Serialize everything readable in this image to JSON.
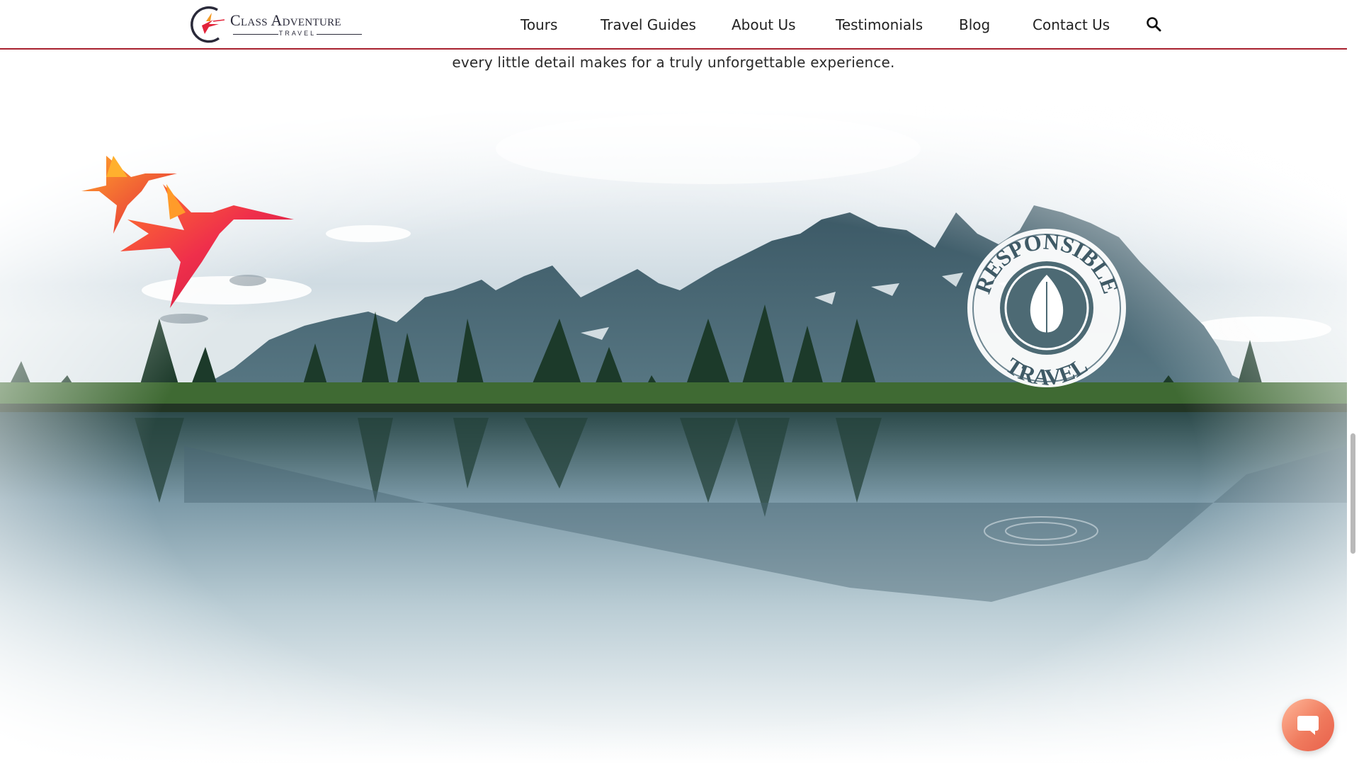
{
  "brand": {
    "name": "Class Adventure",
    "tagline": "TRAVEL"
  },
  "nav": {
    "items": [
      {
        "label": "Tours"
      },
      {
        "label": "Travel Guides"
      },
      {
        "label": "About Us"
      },
      {
        "label": "Testimonials"
      },
      {
        "label": "Blog"
      },
      {
        "label": "Contact Us"
      }
    ],
    "search_icon": "search-icon"
  },
  "intro": {
    "text": "every little detail makes for a truly unforgettable experience."
  },
  "hero": {
    "badge_top": "RESPONSIBLE",
    "badge_bottom": "TRAVEL",
    "badge_icon": "leaf-icon",
    "birds_icon": "hummingbird-icon"
  },
  "chat": {
    "icon": "chat-bubble-icon"
  },
  "colors": {
    "accent": "#a8202e",
    "chat": "#f07b5e",
    "text": "#222222"
  }
}
